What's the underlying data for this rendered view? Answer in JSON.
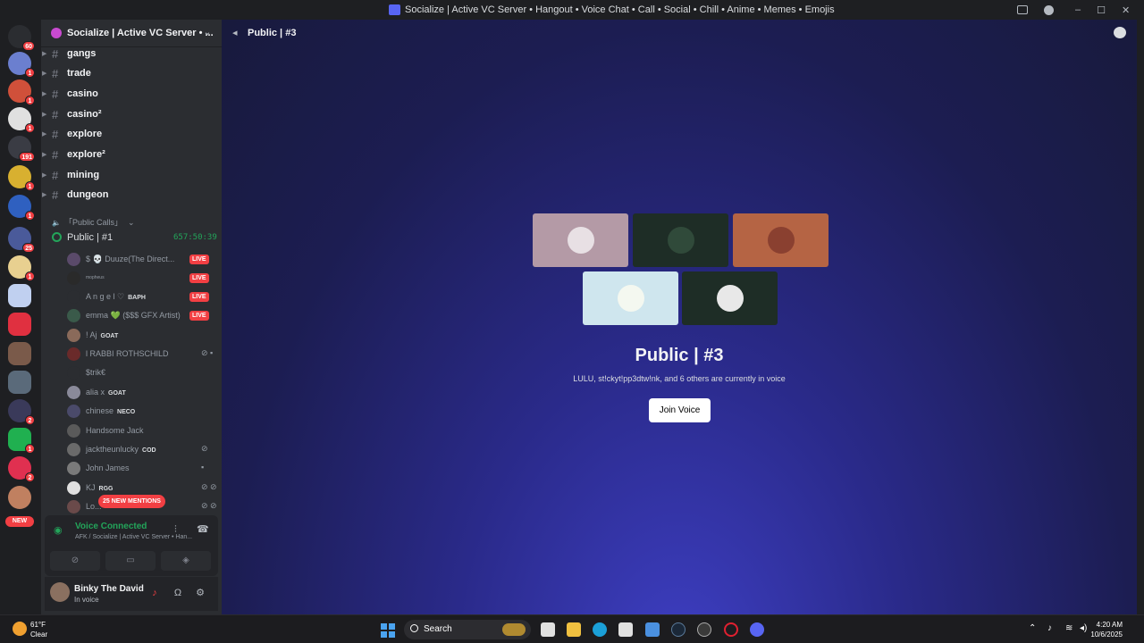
{
  "window": {
    "title": "Socialize | Active VC Server • Hangout • Voice Chat • Call • Social • Chill • Anime • Memes • Emojis"
  },
  "rail": {
    "badges": [
      "60",
      "1",
      "1",
      "1",
      "191",
      "1",
      "1",
      "25",
      "1",
      "2",
      "1",
      "2"
    ],
    "new_label": "NEW"
  },
  "server": {
    "name": "Socialize | Active VC Server • ..."
  },
  "channels": [
    "gangs",
    "trade",
    "casino",
    "casino²",
    "explore",
    "explore²",
    "mining",
    "dungeon"
  ],
  "category": "「Public Calls」",
  "voice_channel": {
    "name": "Public | #1",
    "timer": "657:50:39"
  },
  "members": [
    {
      "name": "$ 💀 Duuze(The Direct...",
      "tag": "",
      "live": "LIVE"
    },
    {
      "name": "mopheus",
      "tag": "",
      "live": "LIVE"
    },
    {
      "name": "A n g e l ♡",
      "tag": "BAPH",
      "live": "LIVE"
    },
    {
      "name": "emma 💚 ($$$ GFX Artist)",
      "tag": "",
      "live": "LIVE"
    },
    {
      "name": "! Aj",
      "tag": "GOAT",
      "live": ""
    },
    {
      "name": "l RABBI ROTHSCHILD",
      "tag": "",
      "live": ""
    },
    {
      "name": "$trik€",
      "tag": "",
      "live": ""
    },
    {
      "name": "alia x",
      "tag": "GOAT",
      "live": ""
    },
    {
      "name": "chinese",
      "tag": "NECO",
      "live": ""
    },
    {
      "name": "Handsome Jack",
      "tag": "",
      "live": ""
    },
    {
      "name": "jacktheunlucky",
      "tag": "COD",
      "live": ""
    },
    {
      "name": "John James",
      "tag": "",
      "live": ""
    },
    {
      "name": "KJ",
      "tag": "RGG",
      "live": ""
    },
    {
      "name": "Lo...",
      "tag": "",
      "live": ""
    }
  ],
  "mentions_label": "25 NEW MENTIONS",
  "voice_panel": {
    "status": "Voice Connected",
    "location": "AFK / Socialize | Active VC Server • Han..."
  },
  "user_panel": {
    "name": "Binky The David",
    "status": "In voice"
  },
  "main": {
    "header": "Public | #3",
    "title": "Public | #3",
    "description": "LULU, st!ckyt!pp3dtw!nk, and 6 others are currently in voice",
    "join_label": "Join Voice",
    "tile_colors": [
      "#b49aa6",
      "#1e2d26",
      "#b56444",
      "#cfe6ee",
      "#1e2d26"
    ]
  },
  "taskbar": {
    "temp": "61°F",
    "condition": "Clear",
    "search_label": "Search",
    "time": "4:20 AM",
    "date": "10/6/2025"
  }
}
